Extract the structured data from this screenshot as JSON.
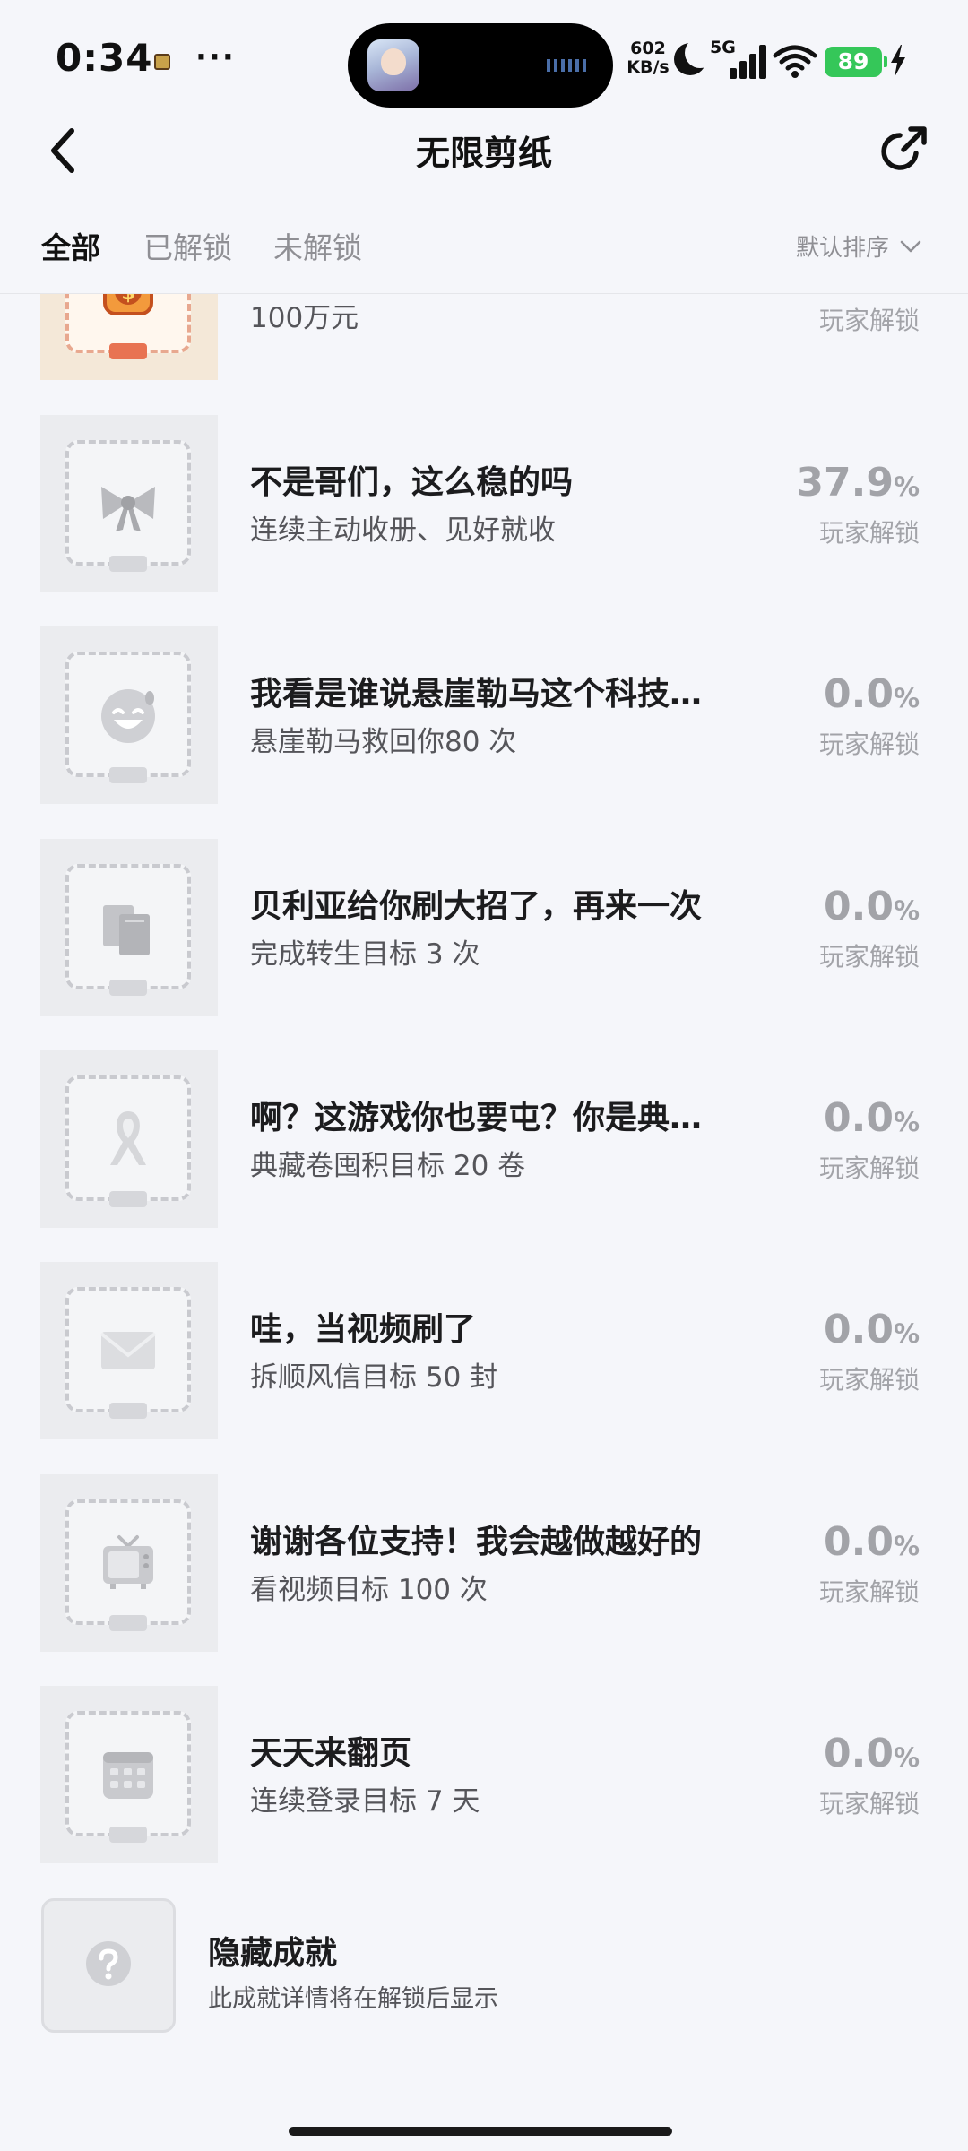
{
  "status_bar": {
    "time": "0:34",
    "dots": "···",
    "net_speed_value": "602",
    "net_speed_unit": "KB/s",
    "network_type": "5G",
    "battery": "89"
  },
  "header": {
    "title": "无限剪纸"
  },
  "tabs": {
    "all": "全部",
    "unlocked": "已解锁",
    "locked": "未解锁",
    "sort_label": "默认排序"
  },
  "achievements": [
    {
      "title": "",
      "desc": "100万元",
      "pct": "",
      "unit": "",
      "unlock_label": "玩家解锁",
      "icon": "coin-icon"
    },
    {
      "title": "不是哥们，这么稳的吗",
      "desc": "连续主动收册、见好就收",
      "pct": "37.9",
      "unit": "%",
      "unlock_label": "玩家解锁",
      "icon": "bow-icon"
    },
    {
      "title": "我看是谁说悬崖勒马这个科技…",
      "desc": "悬崖勒马救回你80 次",
      "pct": "0.0",
      "unit": "%",
      "unlock_label": "玩家解锁",
      "icon": "laugh-face-icon"
    },
    {
      "title": "贝利亚给你刷大招了，再来一次",
      "desc": "完成转生目标 3 次",
      "pct": "0.0",
      "unit": "%",
      "unlock_label": "玩家解锁",
      "icon": "books-icon"
    },
    {
      "title": "啊？这游戏你也要屯？你是典…",
      "desc": "典藏卷囤积目标 20 卷",
      "pct": "0.0",
      "unit": "%",
      "unlock_label": "玩家解锁",
      "icon": "ribbon-icon"
    },
    {
      "title": "哇，当视频刷了",
      "desc": "拆顺风信目标 50 封",
      "pct": "0.0",
      "unit": "%",
      "unlock_label": "玩家解锁",
      "icon": "envelope-icon"
    },
    {
      "title": "谢谢各位支持！我会越做越好的",
      "desc": "看视频目标 100 次",
      "pct": "0.0",
      "unit": "%",
      "unlock_label": "玩家解锁",
      "icon": "tv-icon"
    },
    {
      "title": "天天来翻页",
      "desc": "连续登录目标 7 天",
      "pct": "0.0",
      "unit": "%",
      "unlock_label": "玩家解锁",
      "icon": "calendar-icon"
    }
  ],
  "hidden_achievement": {
    "title": "隐藏成就",
    "desc": "此成就详情将在解锁后显示",
    "icon": "question-icon"
  }
}
